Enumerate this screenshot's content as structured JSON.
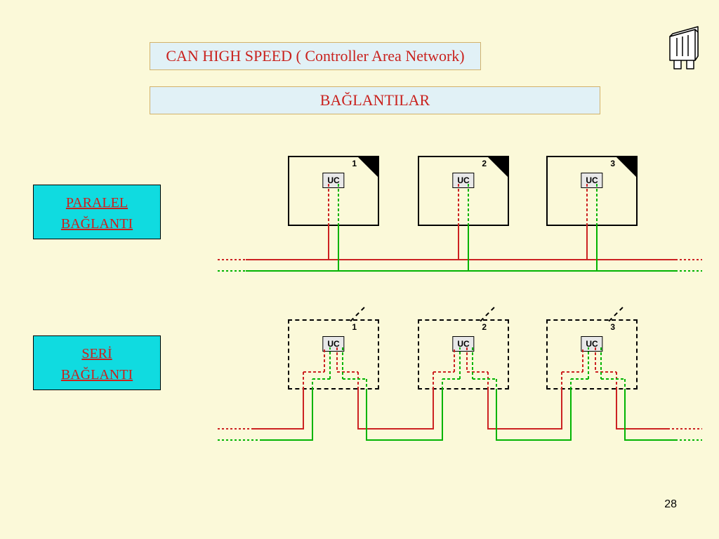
{
  "title": "CAN HIGH SPEED ( Controller Area Network)",
  "subtitle": "BAĞLANTILAR",
  "labels": {
    "parallel_line1": "PARALEL",
    "parallel_line2": "BAĞLANTI",
    "serial_line1": "SERİ",
    "serial_line2": "BAĞLANTI"
  },
  "modules": {
    "uc_label": "UC",
    "numbers": [
      "1",
      "2",
      "3"
    ]
  },
  "page_number": "28",
  "colors": {
    "bus_hi": "#cc2222",
    "bus_lo": "#00b400"
  }
}
